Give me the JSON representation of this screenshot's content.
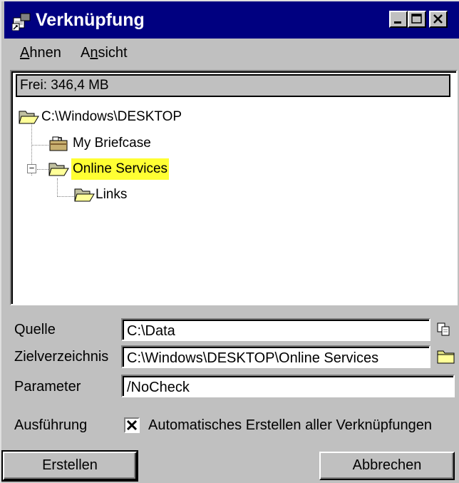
{
  "window": {
    "title": "Verknüpfung",
    "controls": {
      "minimize": "minimize-button",
      "maximize": "maximize-button",
      "close": "close-button"
    }
  },
  "menu": [
    {
      "label": "Ahnen",
      "accelerator": "A"
    },
    {
      "label": "Ansicht",
      "accelerator": "n"
    }
  ],
  "status": {
    "text": "Frei: 346,4 MB"
  },
  "tree": [
    {
      "label": "C:\\Windows\\DESKTOP",
      "icon": "open-folder-icon",
      "level": 0,
      "selected": false
    },
    {
      "label": "My Briefcase",
      "icon": "briefcase-icon",
      "level": 1,
      "selected": false
    },
    {
      "label": "Online Services",
      "icon": "open-folder-icon",
      "level": 1,
      "selected": true,
      "expanded": true
    },
    {
      "label": "Links",
      "icon": "open-folder-icon",
      "level": 2,
      "selected": false
    }
  ],
  "form": {
    "source": {
      "label": "Quelle",
      "value": "C:\\Data",
      "icon": "copy-icon"
    },
    "target": {
      "label": "Zielverzeichnis",
      "value": "C:\\Windows\\DESKTOP\\Online Services",
      "icon": "folder-icon"
    },
    "params": {
      "label": "Parameter",
      "value": "/NoCheck"
    },
    "execution": {
      "label": "Ausführung",
      "checkbox_label": "Automatisches Erstellen aller Verknüpfungen",
      "checked": true
    }
  },
  "buttons": {
    "create": "Erstellen",
    "cancel": "Abbrechen"
  },
  "colors": {
    "titlebar": "#000080",
    "face": "#c0c0c0",
    "highlight": "#ffff33"
  }
}
